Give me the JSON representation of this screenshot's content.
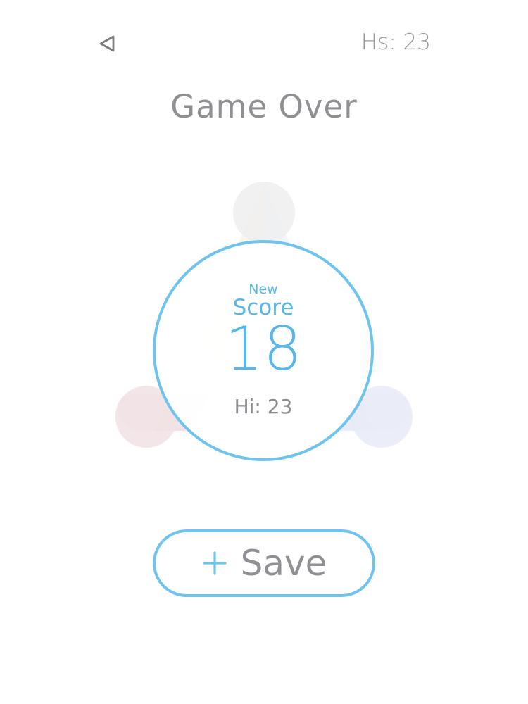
{
  "header": {
    "high_score_text": "Hs: 23",
    "back_icon": "back-triangle-icon"
  },
  "title": "Game Over",
  "score_card": {
    "new_label": "New",
    "score_label": "Score",
    "score_value": "18",
    "hi_text": "Hi: 23"
  },
  "actions": {
    "save_icon": "plus-icon",
    "save_label": "Save"
  },
  "colors": {
    "accent": "#6fc4ef",
    "text": "#8f8f94",
    "background": "#ffffff"
  }
}
